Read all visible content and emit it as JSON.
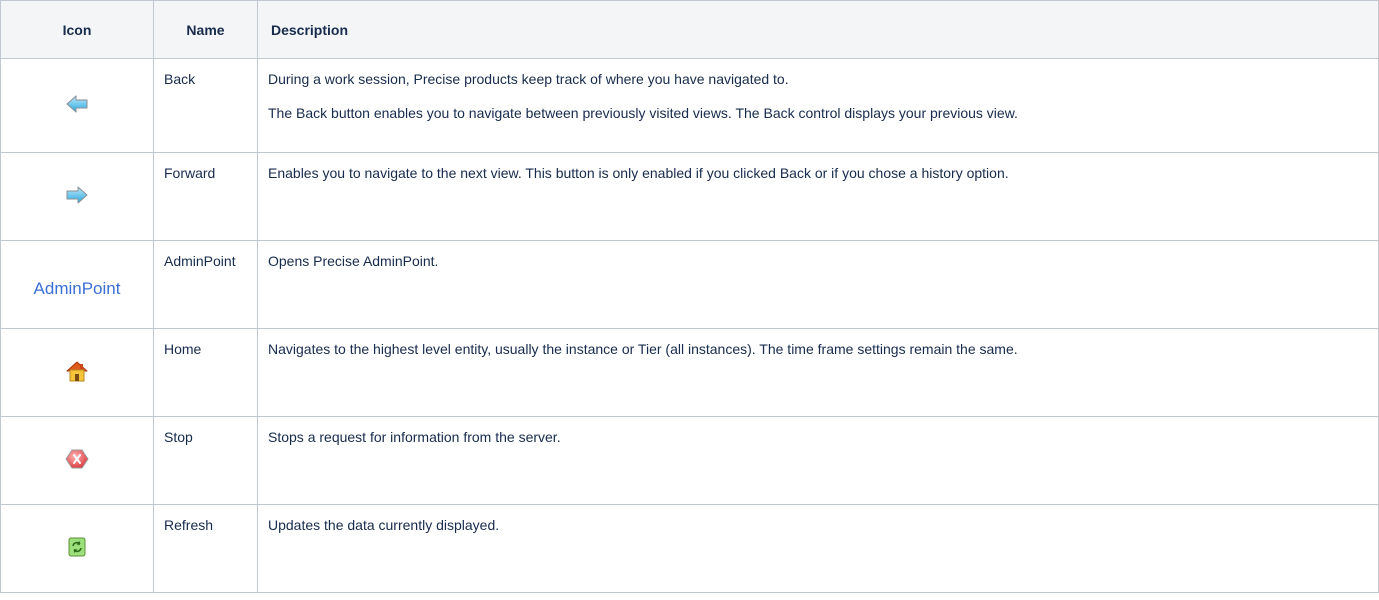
{
  "table": {
    "headers": {
      "icon": "Icon",
      "name": "Name",
      "description": "Description"
    },
    "rows": [
      {
        "icon": "back-arrow-icon",
        "name": "Back",
        "description": [
          "During a work session, Precise products keep track of where you have navigated to.",
          "The Back button enables you to navigate between previously visited views. The Back control displays your previous view."
        ]
      },
      {
        "icon": "forward-arrow-icon",
        "name": "Forward",
        "description": [
          "Enables you to navigate to the next view. This button is only enabled if you clicked Back or if you chose a history option."
        ]
      },
      {
        "icon": "adminpoint-text-icon",
        "icon_text": "AdminPoint",
        "name": "AdminPoint",
        "description": [
          "Opens Precise AdminPoint."
        ]
      },
      {
        "icon": "home-icon",
        "name": "Home",
        "description": [
          "Navigates to the highest level entity, usually the instance or Tier (all instances). The time frame settings remain the same."
        ]
      },
      {
        "icon": "stop-icon",
        "name": "Stop",
        "description": [
          "Stops a request for information from the server."
        ]
      },
      {
        "icon": "refresh-icon",
        "name": "Refresh",
        "description": [
          "Updates the data currently displayed."
        ]
      }
    ]
  },
  "colors": {
    "header_bg": "#f4f5f7",
    "border": "#c1c7d0",
    "text": "#172b4d",
    "adminpoint_link": "#3b6fd6"
  }
}
